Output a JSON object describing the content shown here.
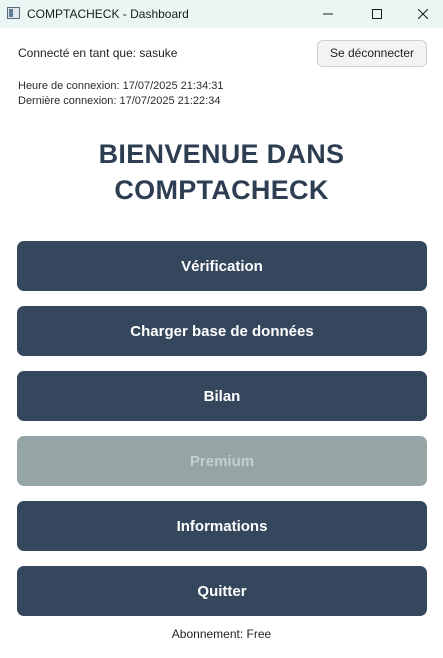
{
  "window": {
    "title": "COMPTACHECK - Dashboard",
    "icon": "app-window-icon",
    "controls": [
      "minimize-icon",
      "maximize-icon",
      "close-icon"
    ]
  },
  "header": {
    "logged_in_text": "Connecté en tant que: sasuke",
    "logout_label": "Se déconnecter",
    "login_time_text": "Heure de connexion: 17/07/2025 21:34:31",
    "last_login_text": "Dernière connexion: 17/07/2025 21:22:34"
  },
  "main": {
    "title_line1": "BIENVENUE DANS",
    "title_line2": "COMPTACHECK",
    "buttons": [
      {
        "label": "Vérification",
        "enabled": true
      },
      {
        "label": "Charger base de données",
        "enabled": true
      },
      {
        "label": "Bilan",
        "enabled": true
      },
      {
        "label": "Premium",
        "enabled": false
      },
      {
        "label": "Informations",
        "enabled": true
      },
      {
        "label": "Quitter",
        "enabled": true
      }
    ]
  },
  "footer": {
    "subscription_text": "Abonnement: Free"
  },
  "colors": {
    "titlebar": "#eaf6f4",
    "button_bg": "#34475d",
    "button_disabled_bg": "#95a5a6",
    "button_disabled_text": "#c4cfd0",
    "heading": "#2e3e52"
  }
}
